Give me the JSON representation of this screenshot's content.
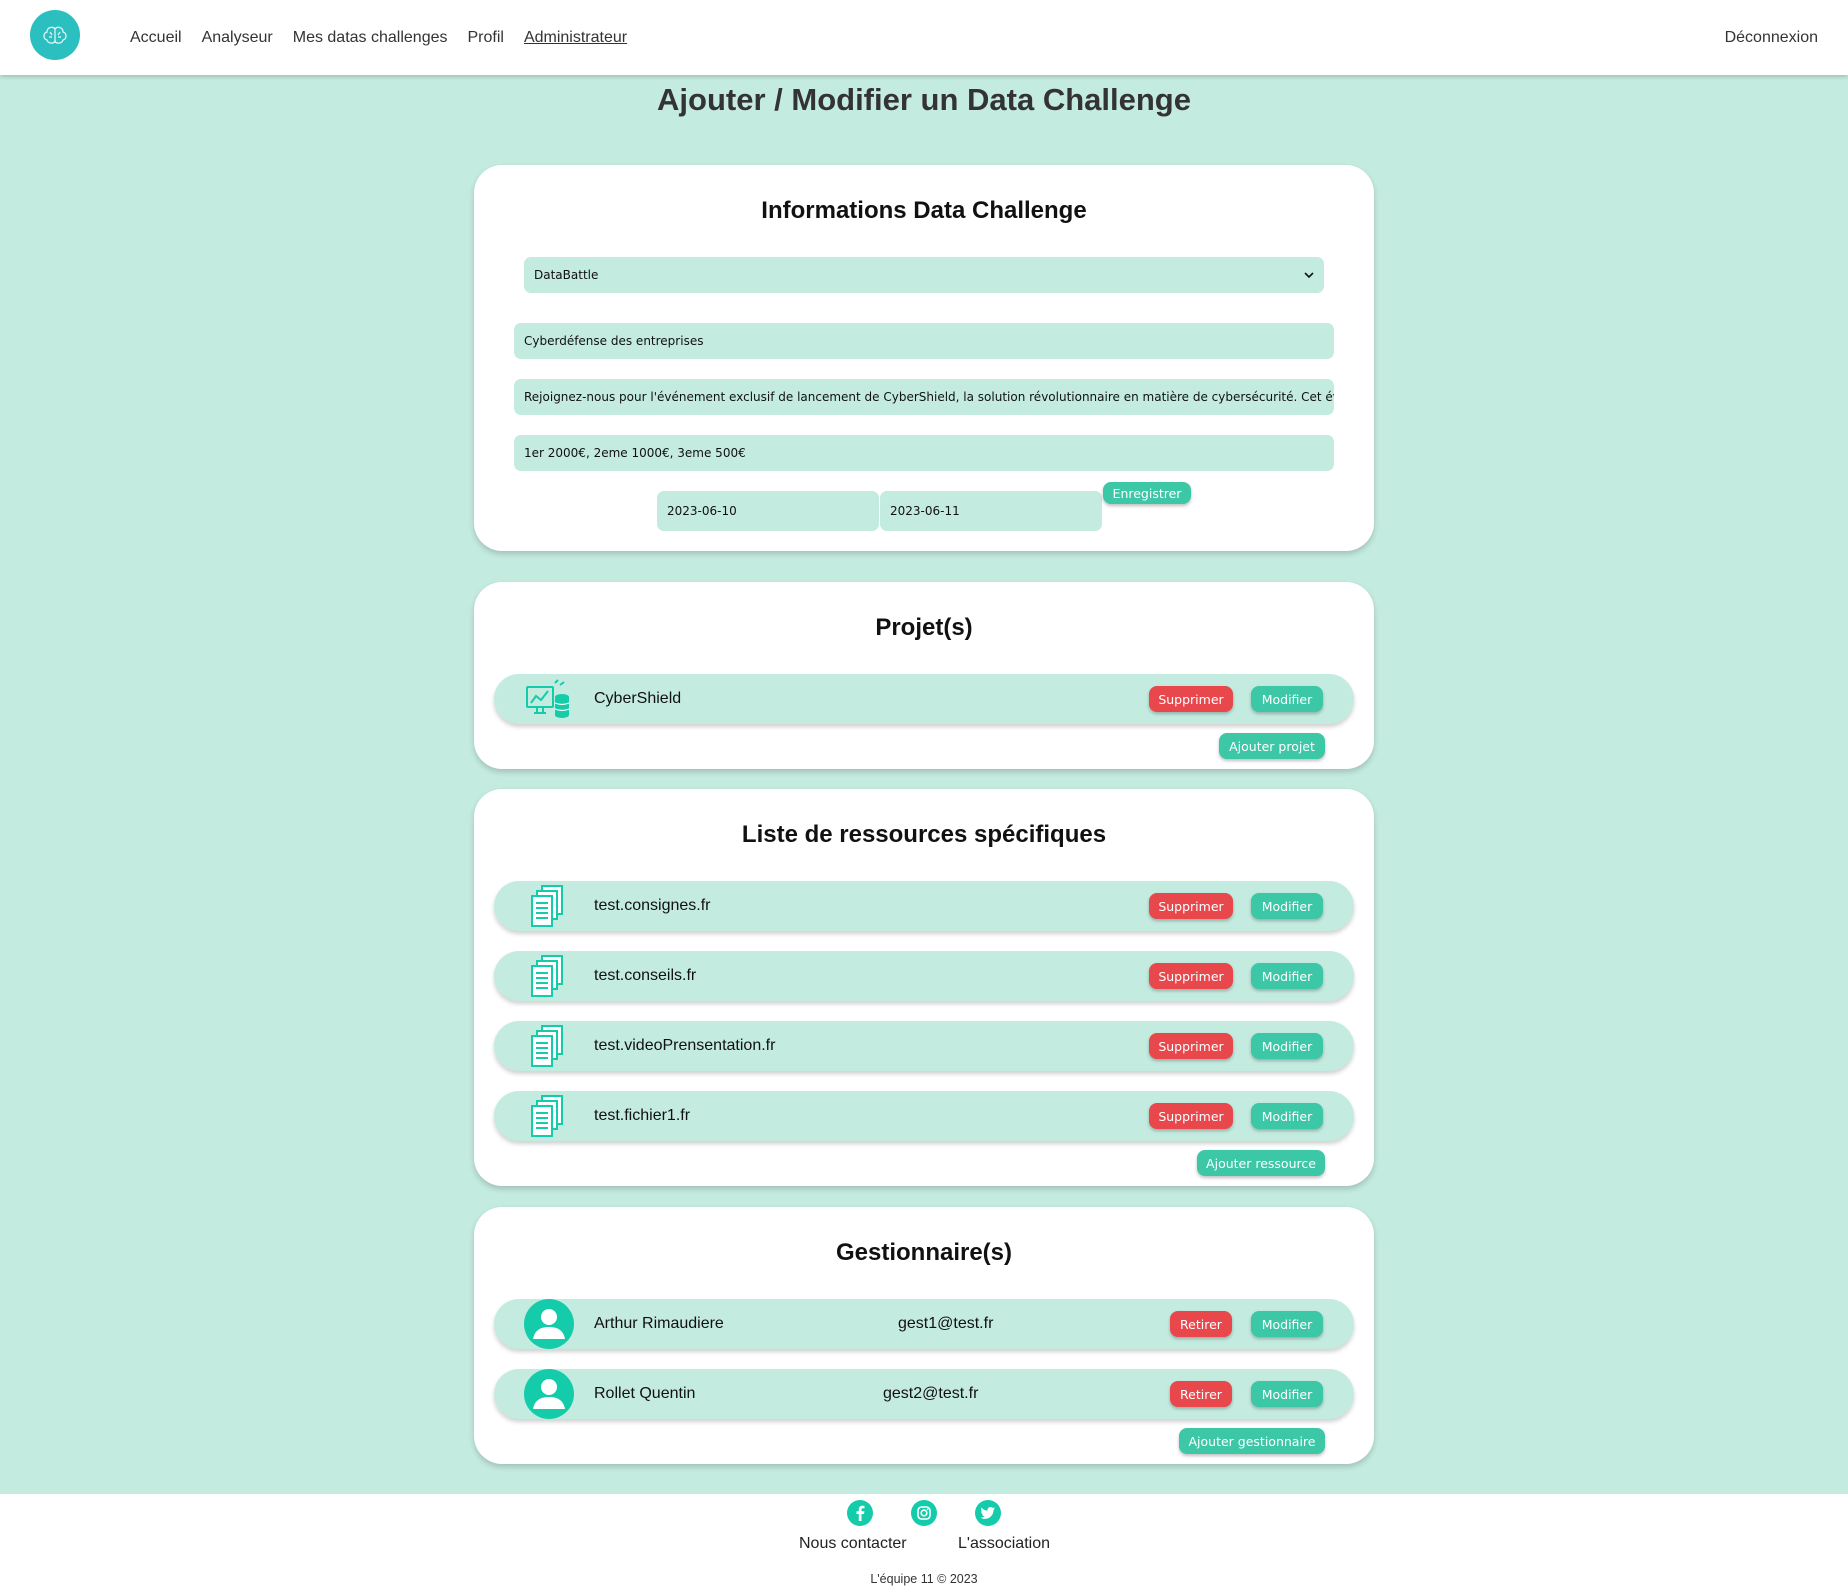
{
  "nav": {
    "links": [
      "Accueil",
      "Analyseur",
      "Mes datas challenges",
      "Profil",
      "Administrateur"
    ],
    "logout": "Déconnexion"
  },
  "page_title": "Ajouter / Modifier un Data Challenge",
  "info": {
    "title": "Informations Data Challenge",
    "type_select": "DataBattle",
    "name": "Cyberdéfense des entreprises",
    "description": "Rejoignez-nous pour l'événement exclusif de lancement de CyberShield, la solution révolutionnaire en matière de cybersécurité. Cet événement",
    "prizes": "1er 2000€, 2eme 1000€, 3eme 500€",
    "start_date": "2023-06-10",
    "end_date": "2023-06-11",
    "save_label": "Enregistrer"
  },
  "projects": {
    "title": "Projet(s)",
    "items": [
      {
        "name": "CyberShield"
      }
    ],
    "delete_label": "Supprimer",
    "edit_label": "Modifier",
    "add_label": "Ajouter projet"
  },
  "resources": {
    "title": "Liste de ressources spécifiques",
    "items": [
      {
        "name": "test.consignes.fr"
      },
      {
        "name": "test.conseils.fr"
      },
      {
        "name": "test.videoPrensentation.fr"
      },
      {
        "name": "test.fichier1.fr"
      }
    ],
    "delete_label": "Supprimer",
    "edit_label": "Modifier",
    "add_label": "Ajouter ressource"
  },
  "managers": {
    "title": "Gestionnaire(s)",
    "items": [
      {
        "name": "Arthur Rimaudiere",
        "email": "gest1@test.fr"
      },
      {
        "name": "Rollet Quentin",
        "email": "gest2@test.fr"
      }
    ],
    "remove_label": "Retirer",
    "edit_label": "Modifier",
    "add_label": "Ajouter gestionnaire"
  },
  "footer": {
    "social_icons": [
      "facebook-icon",
      "instagram-icon",
      "twitter-icon"
    ],
    "contact": "Nous contacter",
    "association": "L'association",
    "copyright": "L'équipe 11 © 2023"
  },
  "colors": {
    "background": "#c4ebe0",
    "accent": "#3cc7a7",
    "danger": "#e8474c",
    "logo": "#2cbfbf"
  }
}
